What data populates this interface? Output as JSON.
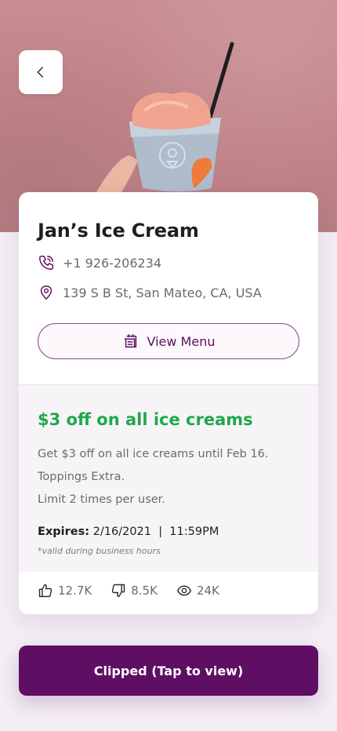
{
  "header": {
    "back_icon": "chevron-left-icon"
  },
  "store": {
    "name": "Jan’s Ice Cream",
    "phone": "+1 926-206234",
    "address": "139 S B St, San Mateo, CA, USA",
    "phone_icon": "phone-icon",
    "location_icon": "location-pin-icon"
  },
  "actions": {
    "view_menu_label": "View Menu",
    "view_menu_icon": "menu-icon",
    "clipped_label": "Clipped (Tap to view)"
  },
  "offer": {
    "title": "$3 off on all ice creams",
    "description": [
      "Get $3 off on all ice creams until Feb 16.",
      "Toppings Extra.",
      "Limit 2 times per user."
    ],
    "expires_label": "Expires:",
    "expires_value": "2/16/2021  |  11:59PM",
    "note": "*valid during business hours"
  },
  "stats": {
    "likes": "12.7K",
    "dislikes": "8.5K",
    "views": "24K",
    "like_icon": "thumbs-up-icon",
    "dislike_icon": "thumbs-down-icon",
    "view_icon": "eye-icon"
  },
  "colors": {
    "accent": "#5e0f63",
    "offer_green": "#1fa84a",
    "background": "#f3edf4"
  }
}
